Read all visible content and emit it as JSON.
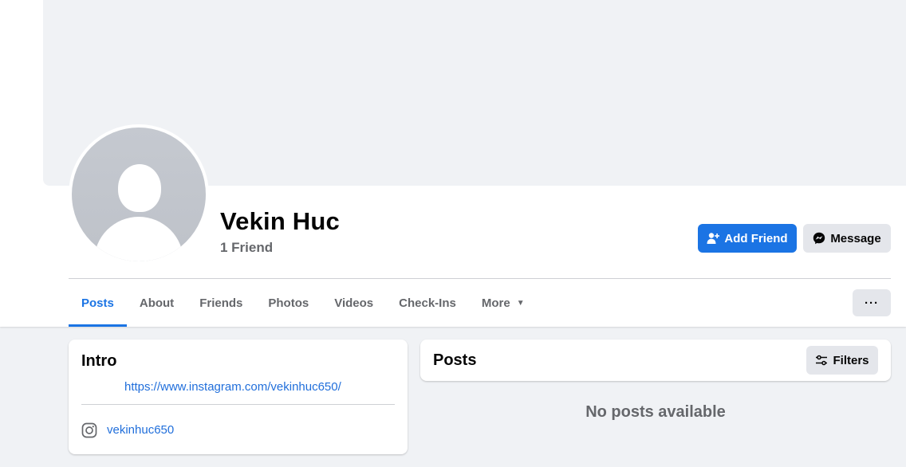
{
  "profile": {
    "name": "Vekin Huc",
    "friend_count": "1 Friend"
  },
  "actions": {
    "add_friend_label": "Add Friend",
    "message_label": "Message",
    "overflow_label": "···"
  },
  "tabs": [
    {
      "label": "Posts",
      "active": true
    },
    {
      "label": "About"
    },
    {
      "label": "Friends"
    },
    {
      "label": "Photos"
    },
    {
      "label": "Videos"
    },
    {
      "label": "Check-Ins"
    },
    {
      "label": "More"
    }
  ],
  "intro": {
    "title": "Intro",
    "link": "https://www.instagram.com/vekinhuc650/",
    "instagram_handle": "vekinhuc650"
  },
  "posts": {
    "title": "Posts",
    "filters_label": "Filters",
    "empty_message": "No posts available"
  },
  "icons": {
    "add_friend": "add-person-icon",
    "message": "messenger-icon",
    "more": "caret-down-icon",
    "filters": "sliders-icon",
    "instagram": "instagram-icon"
  },
  "colors": {
    "accent": "#1b74e4",
    "link": "#216fdb",
    "background": "#f0f2f5",
    "secondary_button": "#e4e6eb",
    "muted_text": "#65676b"
  }
}
